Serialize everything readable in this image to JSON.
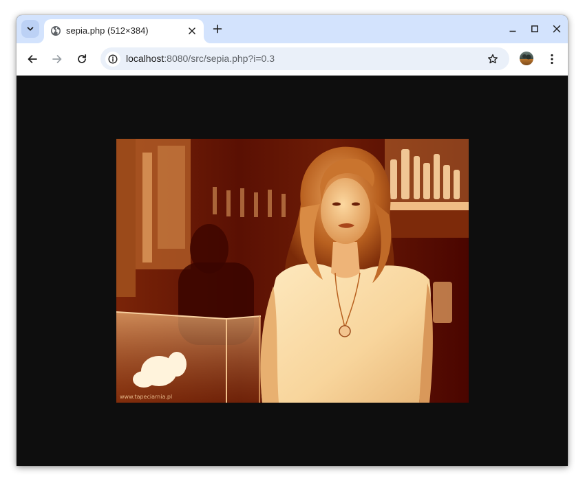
{
  "tab": {
    "title": "sepia.php (512×384)",
    "favicon": "globe-icon"
  },
  "address_bar": {
    "host": "localhost",
    "path": ":8080/src/sepia.php?i=0.3"
  },
  "icons": {
    "tab_search": "chevron-down-icon",
    "close_tab": "close-icon",
    "new_tab": "plus-icon",
    "minimize": "minimize-icon",
    "maximize": "maximize-icon",
    "close_window": "close-icon",
    "back": "arrow-left-icon",
    "forward": "arrow-right-icon",
    "reload": "reload-icon",
    "site_info": "info-icon",
    "bookmark": "star-icon",
    "profile": "avatar",
    "menu": "kebab-menu-icon"
  },
  "image": {
    "watermark": "www.tapeciarnia.pl"
  },
  "colors": {
    "tab_strip": "#d3e3fd",
    "omnibox": "#eaf0f9",
    "page_background": "#0e0e0e",
    "sepia_dark": "#4a0500",
    "sepia_light": "#fde3b5"
  }
}
